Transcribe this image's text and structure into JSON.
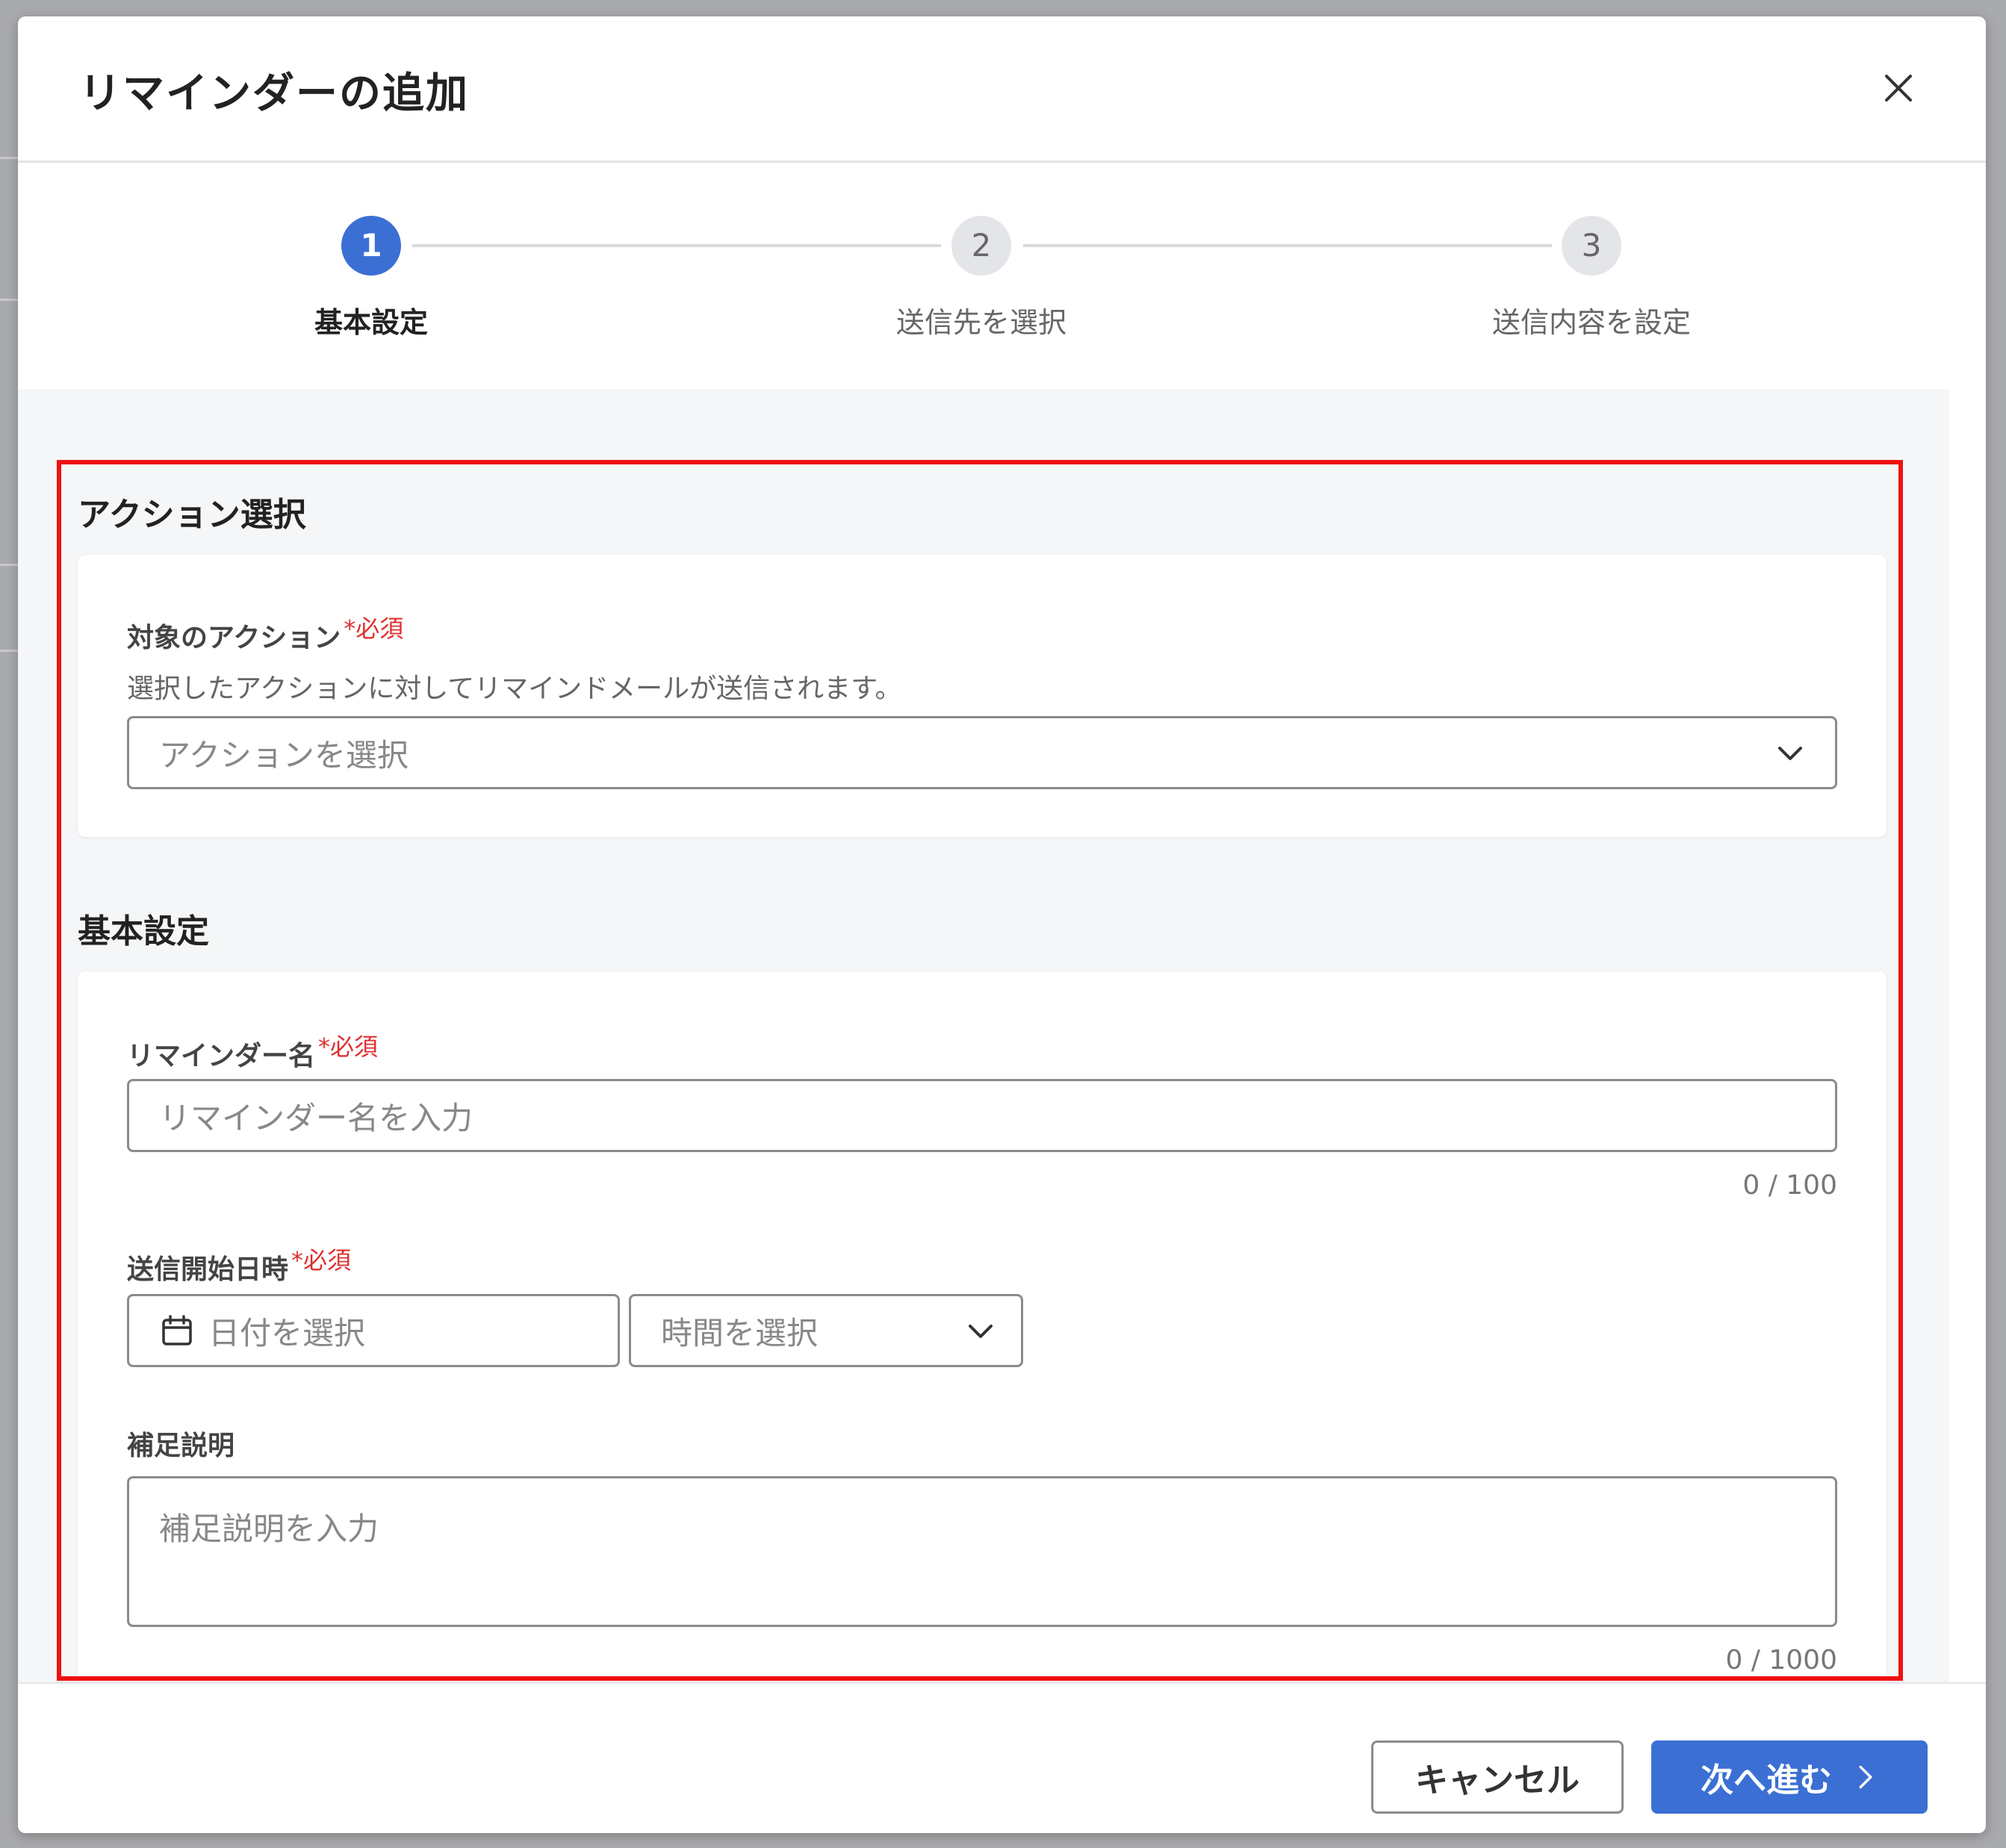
{
  "modal": {
    "title": "リマインダーの追加"
  },
  "stepper": {
    "steps": [
      {
        "number": "1",
        "label": "基本設定",
        "state": "active"
      },
      {
        "number": "2",
        "label": "送信先を選択",
        "state": "inactive"
      },
      {
        "number": "3",
        "label": "送信内容を設定",
        "state": "inactive"
      }
    ]
  },
  "action_section": {
    "title": "アクション選択",
    "target_action": {
      "label": "対象のアクション",
      "required": "*必須",
      "description": "選択したアクションに対してリマインドメールが送信されます。",
      "placeholder": "アクションを選択"
    }
  },
  "basic_section": {
    "title": "基本設定",
    "reminder_name": {
      "label": "リマインダー名",
      "required": "*必須",
      "placeholder": "リマインダー名を入力",
      "counter": "0 / 100"
    },
    "send_start": {
      "label": "送信開始日時",
      "required": "*必須",
      "date_placeholder": "日付を選択",
      "time_placeholder": "時間を選択"
    },
    "note": {
      "label": "補足説明",
      "placeholder": "補足説明を入力",
      "counter": "0 / 1000"
    }
  },
  "footer": {
    "cancel_label": "キャンセル",
    "next_label": "次へ進む"
  },
  "colors": {
    "primary": "#3b6fd4",
    "required": "#e03030",
    "highlight": "#ee1111"
  }
}
